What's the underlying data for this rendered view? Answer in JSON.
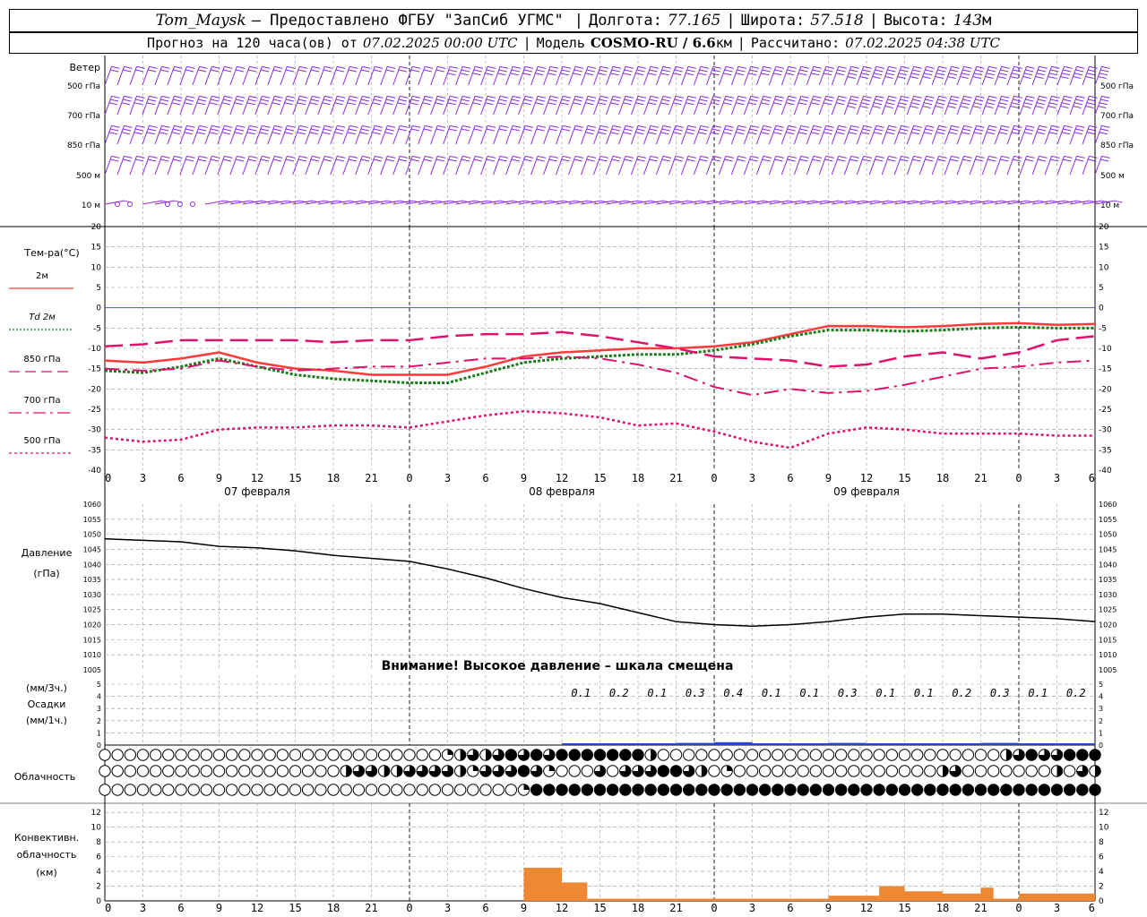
{
  "header": {
    "station": "Tom_Maysk",
    "provider": "– Предоставлено ФГБУ \"ЗапСиб УГМС\"",
    "lon_label": "Долгота:",
    "lon_value": "77.165",
    "lat_label": "Широта:",
    "lat_value": "57.518",
    "alt_label": "Высота:",
    "alt_value": "143",
    "alt_unit": "м",
    "forecast_label": "Прогноз на 120 часа(ов) от",
    "forecast_from": "07.02.2025 00:00 UTC",
    "model_label": "Модель",
    "model_name": "COSMO-RU / 6.6",
    "model_unit": "км",
    "calc_label": "Рассчитано:",
    "calc_time": "07.02.2025 04:38 UTC"
  },
  "colors": {
    "wind": "#8a2be2",
    "t2m": "#ff3a3a",
    "td2m": "#1a7a1a",
    "t850": "#e0106e",
    "t700": "#e0106e",
    "t500": "#e0106e",
    "zero": "#3355ff",
    "pressure": "#000000",
    "precip": "#2244dd",
    "convective": "#ee8833",
    "grid": "#999999"
  },
  "wind_panel": {
    "title": "Ветер",
    "levels": [
      "500 гПа",
      "700 гПа",
      "850 гПа",
      "500 м",
      "10 м"
    ]
  },
  "temp_panel": {
    "title": "Тем-ра(°С)",
    "legend": [
      {
        "label": "2м",
        "key": "t2m",
        "style": "solid"
      },
      {
        "label": "Td  2м",
        "key": "td2m",
        "style": "dotted"
      },
      {
        "label": "850 гПа",
        "key": "t850",
        "style": "dashed"
      },
      {
        "label": "700 гПа",
        "key": "t700",
        "style": "dashdot"
      },
      {
        "label": "500 гПа",
        "key": "t500",
        "style": "dots"
      }
    ],
    "ticks": [
      "20",
      "15",
      "10",
      "5",
      "0",
      "-5",
      "-10",
      "-15",
      "-20",
      "-25",
      "-30",
      "-35",
      "-40"
    ]
  },
  "time_axis": {
    "hour_labels": [
      "0",
      "3",
      "6",
      "9",
      "12",
      "15",
      "18",
      "21",
      "0",
      "3",
      "6",
      "9",
      "12",
      "15",
      "18",
      "21",
      "0",
      "3",
      "6",
      "9",
      "12",
      "15",
      "18",
      "21",
      "0",
      "3",
      "6"
    ],
    "days": [
      "07 февраля",
      "08 февраля",
      "09 февраля"
    ]
  },
  "pressure_panel": {
    "title": "Давление",
    "unit": "(гПа)",
    "ticks": [
      "1060",
      "1055",
      "1050",
      "1045",
      "1040",
      "1035",
      "1030",
      "1025",
      "1020",
      "1015",
      "1010",
      "1005"
    ],
    "warning": "Внимание! Высокое давление – шкала смещена"
  },
  "precip_panel": {
    "unit3h": "(мм/3ч.)",
    "title": "Осадки",
    "unit1h": "(мм/1ч.)",
    "ticks": [
      "5",
      "4",
      "3",
      "2",
      "1",
      "0"
    ],
    "labels": [
      "0.1",
      "0.2",
      "0.1",
      "0.3",
      "0.4",
      "0.1",
      "0.1",
      "0.3",
      "0.1",
      "0.1",
      "0.2",
      "0.3",
      "0.1",
      "0.2"
    ]
  },
  "cloud_panel": {
    "title": "Облачность"
  },
  "conv_panel": {
    "title1": "Конвективн.",
    "title2": "облачность",
    "unit": "(км)",
    "ticks": [
      "12",
      "10",
      "8",
      "6",
      "4",
      "2",
      "0"
    ]
  },
  "chart_data": {
    "type": "line",
    "x_hours": [
      0,
      3,
      6,
      9,
      12,
      15,
      18,
      21,
      24,
      27,
      30,
      33,
      36,
      39,
      42,
      45,
      48,
      51,
      54,
      57,
      60,
      63,
      66,
      69,
      72,
      75,
      78
    ],
    "series": [
      {
        "name": "2м",
        "values": [
          -13,
          -13.5,
          -12.5,
          -11,
          -13.5,
          -15,
          -15.5,
          -16.5,
          -16.5,
          -16.5,
          -14.5,
          -12,
          -11,
          -10.5,
          -10,
          -10,
          -9.5,
          -8.5,
          -6.5,
          -4.5,
          -4.5,
          -4.8,
          -4.5,
          -4,
          -3.8,
          -4.2,
          -4
        ]
      },
      {
        "name": "Td  2м",
        "values": [
          -15.5,
          -16,
          -14.5,
          -12.5,
          -14.5,
          -16.5,
          -17.5,
          -18,
          -18.5,
          -18.5,
          -16,
          -13.5,
          -12.5,
          -12,
          -11.5,
          -11.5,
          -10.5,
          -9,
          -7,
          -5.5,
          -5.5,
          -5.8,
          -5.5,
          -5,
          -4.8,
          -5,
          -5
        ]
      },
      {
        "name": "850 гПа",
        "values": [
          -9.5,
          -9,
          -8,
          -8,
          -8,
          -8,
          -8.5,
          -8,
          -8,
          -7,
          -6.5,
          -6.5,
          -6,
          -7,
          -8.5,
          -10,
          -12,
          -12.5,
          -13,
          -14.5,
          -14,
          -12,
          -11,
          -12.5,
          -11,
          -8,
          -7
        ]
      },
      {
        "name": "700 гПа",
        "values": [
          -15,
          -15.5,
          -15,
          -13,
          -14.5,
          -15.5,
          -15,
          -14.5,
          -14.5,
          -13.5,
          -12.5,
          -12.5,
          -12,
          -12.5,
          -14,
          -16,
          -19.5,
          -21.5,
          -20,
          -21,
          -20.5,
          -19,
          -17,
          -15,
          -14.5,
          -13.5,
          -13
        ]
      },
      {
        "name": "500 гПа",
        "values": [
          -32,
          -33,
          -32.5,
          -30,
          -29.5,
          -29.5,
          -29,
          -29,
          -29.5,
          -28,
          -26.5,
          -25.5,
          -26,
          -27,
          -29,
          -28.5,
          -30.5,
          -33,
          -34.5,
          -31,
          -29.5,
          -30,
          -31,
          -31,
          -31,
          -31.5,
          -31.5
        ]
      }
    ],
    "pressure": {
      "name": "Давление",
      "ylim": [
        1005,
        1060
      ],
      "values": [
        1048.5,
        1048,
        1047.5,
        1046,
        1045.5,
        1044.5,
        1043,
        1042,
        1041,
        1038.5,
        1035.5,
        1032,
        1029,
        1027,
        1024,
        1021,
        1020,
        1019.5,
        1020,
        1021,
        1022.5,
        1023.5,
        1023.5,
        1023,
        1022.5,
        1022,
        1021
      ]
    },
    "temperature_ylim": [
      -40,
      20
    ],
    "precip_3h": [
      0.1,
      0.2,
      0.1,
      0.3,
      0.4,
      0.1,
      0.1,
      0.3,
      0.1,
      0.1,
      0.2,
      0.3,
      0.1,
      0.2
    ],
    "precip_3h_start_hour": 36,
    "convective_km": [
      0,
      0,
      0,
      0,
      0,
      0,
      0,
      0,
      0,
      0,
      0,
      0,
      0,
      0.2,
      0.2,
      0.2,
      0.2,
      0.2,
      0.2,
      0.2,
      0.2,
      0.2,
      0.2,
      0.2,
      0.2,
      0.2,
      0.2,
      0.2,
      0.2,
      0.2,
      0.2,
      0.2,
      0.2,
      0.2,
      0.2,
      0.2,
      0.2,
      0.2,
      0.2,
      0.2,
      0.2,
      0.2,
      0.2,
      0.2,
      0.2,
      0.2,
      0.2,
      0.2,
      0.2,
      0.2,
      0.2,
      0.2,
      0.2,
      0.2,
      0.2,
      0.2,
      0.2,
      0.2,
      0.2,
      0.2,
      0.2,
      0.2,
      0.2,
      0.2,
      0.2,
      0.2,
      0.2,
      0.2,
      0.2,
      0.2,
      0.2,
      0.2,
      0.2,
      0.2,
      0.2,
      0.2,
      0.2,
      0.2,
      0.2
    ],
    "convective_blocks": [
      {
        "from": 33,
        "to": 36,
        "km": 4.5
      },
      {
        "from": 36,
        "to": 38,
        "km": 2.5
      },
      {
        "from": 38,
        "to": 57,
        "km": 0.3
      },
      {
        "from": 57,
        "to": 61,
        "km": 0.7
      },
      {
        "from": 61,
        "to": 63,
        "km": 2
      },
      {
        "from": 63,
        "to": 66,
        "km": 1.3
      },
      {
        "from": 66,
        "to": 69,
        "km": 1
      },
      {
        "from": 69,
        "to": 70,
        "km": 1.8
      },
      {
        "from": 70,
        "to": 72,
        "km": 0.3
      },
      {
        "from": 72,
        "to": 78,
        "km": 1
      }
    ],
    "convective_ylim": [
      0,
      13
    ],
    "cloud_cover_rows": {
      "upper": [
        0,
        0,
        0,
        0,
        0,
        0,
        0,
        0,
        0,
        0,
        0,
        0,
        0,
        0,
        0,
        0,
        0,
        0,
        0,
        0,
        0,
        0,
        0,
        0,
        0,
        0,
        0,
        0,
        0,
        0,
        0,
        0,
        0,
        0,
        1,
        2,
        2,
        3,
        2,
        3,
        4,
        4,
        3,
        4,
        3,
        4,
        4,
        4,
        4,
        4,
        4,
        4,
        4,
        4,
        3,
        2,
        0,
        0,
        0,
        0,
        0,
        0,
        0,
        0,
        0,
        0,
        0,
        0,
        0,
        0,
        0,
        0,
        0,
        0,
        0,
        0,
        0,
        0,
        0,
        0,
        0,
        0,
        0,
        0,
        0,
        0,
        0,
        0,
        0,
        0,
        2,
        3,
        4,
        4,
        3,
        3,
        4,
        4,
        4,
        4
      ],
      "middle": [
        0,
        0,
        0,
        0,
        0,
        0,
        0,
        0,
        0,
        0,
        0,
        0,
        0,
        0,
        0,
        0,
        0,
        0,
        0,
        0,
        0,
        0,
        0,
        0,
        0,
        0,
        0,
        0,
        1,
        2,
        3,
        2,
        3,
        2,
        3,
        2,
        3,
        3,
        3,
        3,
        3,
        3,
        2,
        3,
        1,
        3,
        3,
        3,
        3,
        4,
        4,
        3,
        2,
        1,
        0,
        0,
        0,
        0,
        2,
        3,
        2,
        0,
        3,
        4,
        3,
        3,
        4,
        4,
        4,
        4,
        3,
        2,
        1,
        0,
        1,
        0,
        0,
        0,
        0,
        0,
        0,
        0,
        0,
        0,
        0,
        0,
        0,
        0,
        0,
        0,
        4,
        0,
        0,
        0,
        0,
        0,
        0,
        0,
        0,
        0,
        2,
        3,
        0,
        0,
        0,
        0,
        0,
        0,
        0,
        0,
        0,
        0,
        0,
        2,
        0,
        0,
        3,
        3,
        2
      ],
      "low": [
        0,
        0,
        0,
        0,
        0,
        0,
        0,
        0,
        0,
        0,
        0,
        0,
        0,
        0,
        0,
        0,
        0,
        0,
        0,
        0,
        0,
        0,
        0,
        0,
        0,
        0,
        0,
        0,
        0,
        0,
        0,
        0,
        0,
        0,
        0,
        0,
        0,
        0,
        0,
        0,
        0,
        0,
        0,
        0,
        0,
        1,
        4,
        4,
        4,
        4,
        4,
        4,
        4,
        4,
        4,
        4,
        4,
        4,
        4,
        4,
        4,
        4,
        4,
        4,
        4,
        4,
        4,
        4,
        4,
        4,
        4,
        4,
        4,
        4,
        4,
        4,
        4,
        4,
        4,
        4,
        4,
        4,
        4,
        4,
        4,
        4,
        4,
        4,
        4,
        4,
        4,
        4,
        4,
        4,
        4,
        4,
        4,
        4,
        4,
        4,
        4,
        4,
        4,
        4,
        4,
        4,
        4
      ]
    },
    "wind_barbs": {
      "levels": [
        "500 гПа",
        "700 гПа",
        "850 гПа",
        "500 м",
        "10 м"
      ],
      "speed_class": [
        [
          2,
          2,
          2,
          2,
          2,
          2,
          2,
          2,
          2,
          2,
          2,
          2,
          2,
          2,
          2,
          2,
          2,
          2,
          2,
          2,
          2,
          2,
          2,
          2,
          2,
          2,
          2,
          3,
          3,
          3,
          3,
          3,
          3,
          3,
          3,
          3,
          3,
          3,
          3,
          3,
          3,
          3,
          3,
          3,
          3,
          3,
          3,
          3,
          3,
          3,
          3,
          3,
          3,
          3,
          3,
          3,
          3,
          3,
          3,
          4,
          4,
          4,
          4,
          4,
          4,
          4,
          4,
          4,
          4,
          4,
          4,
          4,
          4,
          4,
          4,
          4,
          4,
          4,
          4,
          4
        ],
        [
          3,
          3,
          3,
          3,
          3,
          3,
          3,
          3,
          3,
          3,
          3,
          3,
          3,
          3,
          3,
          3,
          3,
          3,
          3,
          3,
          3,
          3,
          3,
          3,
          3,
          3,
          3,
          3,
          3,
          3,
          3,
          3,
          3,
          3,
          3,
          3,
          3,
          3,
          3,
          3,
          3,
          3,
          3,
          3,
          3,
          3,
          3,
          3,
          3,
          3,
          3,
          3,
          3,
          3,
          3,
          3,
          3,
          3,
          3,
          4,
          4,
          4,
          4,
          4,
          4,
          4,
          4,
          4,
          4,
          4,
          4,
          4,
          4,
          4,
          4,
          4,
          4,
          4,
          4,
          4
        ],
        [
          3,
          3,
          3,
          3,
          3,
          3,
          3,
          3,
          3,
          3,
          3,
          3,
          3,
          3,
          3,
          3,
          3,
          3,
          3,
          3,
          3,
          3,
          3,
          2,
          2,
          2,
          2,
          2,
          2,
          2,
          2,
          2,
          2,
          2,
          2,
          2,
          2,
          2,
          3,
          3,
          3,
          3,
          3,
          3,
          3,
          3,
          3,
          3,
          3,
          3,
          3,
          3,
          3,
          3,
          3,
          3,
          3,
          3,
          3,
          3,
          3,
          3,
          3,
          3,
          3,
          3,
          3,
          3,
          3,
          3,
          3,
          3,
          3,
          3,
          3,
          3,
          3,
          3,
          3,
          3
        ],
        [
          2,
          2,
          2,
          2,
          2,
          2,
          2,
          2,
          2,
          2,
          2,
          2,
          2,
          2,
          2,
          2,
          2,
          2,
          2,
          2,
          2,
          2,
          2,
          2,
          2,
          2,
          2,
          2,
          2,
          2,
          2,
          2,
          2,
          2,
          2,
          2,
          2,
          2,
          2,
          2,
          2,
          2,
          2,
          2,
          2,
          2,
          2,
          2,
          2,
          2,
          2,
          2,
          2,
          2,
          2,
          2,
          2,
          2,
          2,
          2,
          2,
          2,
          2,
          2,
          2,
          2,
          2,
          2,
          2,
          2,
          2,
          2,
          2,
          2,
          2,
          2,
          2,
          2,
          2,
          2
        ],
        [
          1,
          0,
          0,
          1,
          1,
          0,
          0,
          0,
          1,
          1,
          1,
          1,
          1,
          1,
          1,
          1,
          1,
          1,
          1,
          1,
          1,
          1,
          1,
          1,
          1,
          1,
          1,
          1,
          1,
          1,
          1,
          1,
          1,
          1,
          1,
          1,
          1,
          1,
          1,
          1,
          1,
          1,
          1,
          1,
          1,
          1,
          1,
          1,
          1,
          1,
          1,
          1,
          1,
          1,
          1,
          1,
          1,
          1,
          1,
          1,
          1,
          1,
          1,
          1,
          1,
          1,
          1,
          1,
          1,
          1,
          1,
          1,
          1,
          1,
          1,
          1,
          1,
          1,
          1,
          1
        ]
      ]
    }
  }
}
